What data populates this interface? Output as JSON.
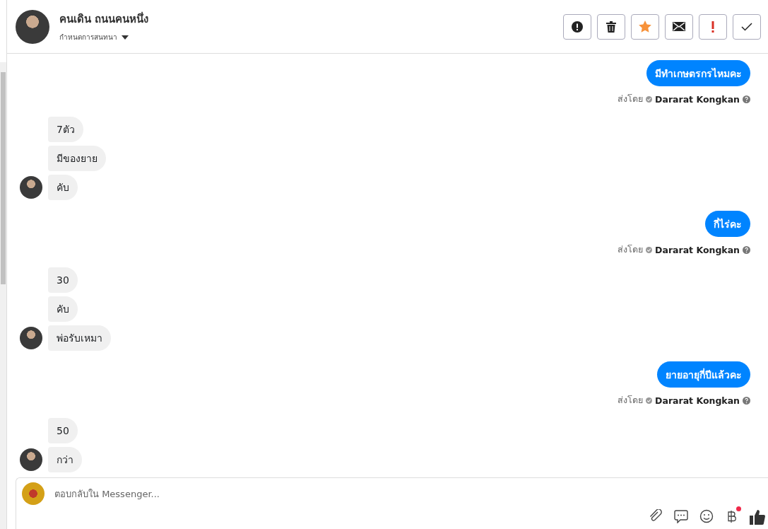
{
  "header": {
    "name": "คนเดิน ถนนคนหนึ่ง",
    "subtitle": "กำหนดการสนทนา"
  },
  "actions": [
    {
      "kind": "alert"
    },
    {
      "kind": "trash"
    },
    {
      "kind": "star"
    },
    {
      "kind": "mail"
    },
    {
      "kind": "important"
    },
    {
      "kind": "done"
    }
  ],
  "messages": [
    {
      "kind": "outgoing",
      "text": "มีทำเกษตรกรไหมคะ",
      "sent_by_label": "ส่งโดย",
      "sender": "Dararat Kongkan"
    },
    {
      "kind": "incoming",
      "bubbles": [
        "7ตัว",
        "มีของยาย",
        "คับ"
      ]
    },
    {
      "kind": "outgoing",
      "text": "กี่ไร่คะ",
      "sent_by_label": "ส่งโดย",
      "sender": "Dararat Kongkan"
    },
    {
      "kind": "incoming",
      "bubbles": [
        "30",
        "คับ",
        "พ่อรับเหมา"
      ]
    },
    {
      "kind": "outgoing",
      "text": "ยายอายุกี่ปีแล้วคะ",
      "sent_by_label": "ส่งโดย",
      "sender": "Dararat Kongkan"
    },
    {
      "kind": "incoming",
      "bubbles": [
        "50",
        "กว่า"
      ]
    }
  ],
  "composer": {
    "placeholder": "ตอบกลับใน Messenger..."
  },
  "tools": [
    {
      "kind": "attach"
    },
    {
      "kind": "reply"
    },
    {
      "kind": "emoji"
    },
    {
      "kind": "baht",
      "badge": true
    },
    {
      "kind": "like"
    }
  ]
}
